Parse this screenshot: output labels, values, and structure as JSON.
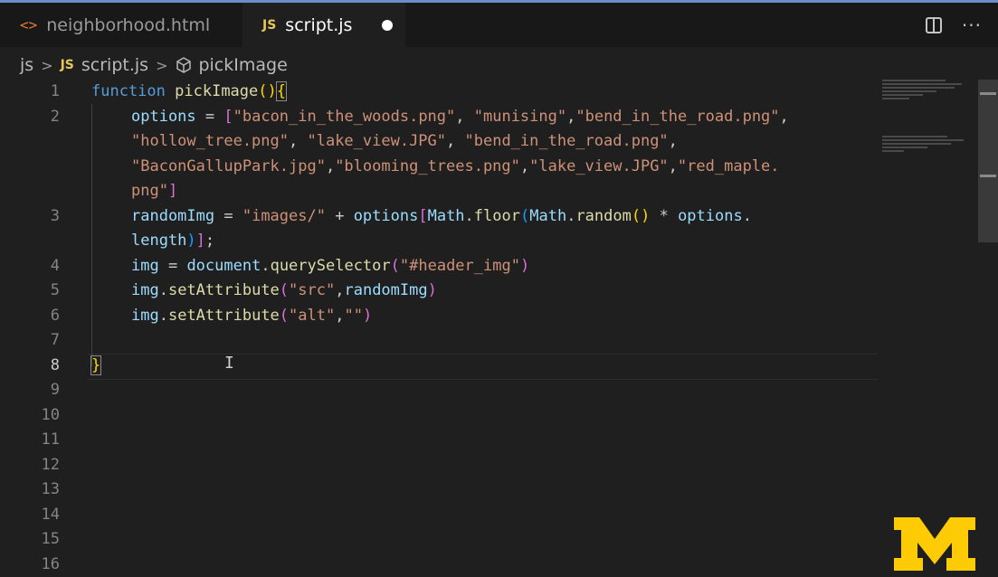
{
  "tabs": [
    {
      "icon": "<>",
      "label": "neighborhood.html"
    },
    {
      "icon": "JS",
      "label": "script.js",
      "dirty": true
    }
  ],
  "breadcrumb": {
    "folder": "js",
    "file_icon": "JS",
    "file": "script.js",
    "symbol": "pickImage"
  },
  "line_numbers": [
    "1",
    "2",
    "",
    "",
    "",
    "3",
    "",
    "4",
    "5",
    "6",
    "7",
    "8",
    "9",
    "10",
    "11",
    "12",
    "13",
    "14",
    "15",
    "16"
  ],
  "code": {
    "l1_kw": "function",
    "l1_fn": "pickImage",
    "l2a_var": "options",
    "l2a_op": " = ",
    "s_bacon_woods": "\"bacon_in_the_woods.png\"",
    "s_munising": "\"munising\"",
    "s_bend1": "\"bend_in_the_road.png\"",
    "s_hollow": "\"hollow_tree.png\"",
    "s_lake1": "\"lake_view.JPG\"",
    "s_bend2": "\"bend_in_the_road.png\"",
    "s_bacon_gallup": "\"BaconGallupPark.jpg\"",
    "s_blooming": "\"blooming_trees.png\"",
    "s_lake2": "\"lake_view.JPG\"",
    "s_red_a": "\"red_maple.",
    "s_red_b": "png\"",
    "l3_var": "randomImg",
    "l3_str": "\"images/\"",
    "l3_opts": "options",
    "l3_math": "Math",
    "l3_floor": "floor",
    "l3_random": "random",
    "l3_opts2": "options",
    "l3_length": "length",
    "l4_var": "img",
    "l4_doc": "document",
    "l4_qs": "querySelector",
    "l4_str": "\"#header_img\"",
    "l5_var": "img",
    "l5_fn": "setAttribute",
    "l5_str": "\"src\"",
    "l5_arg": "randomImg",
    "l6_var": "img",
    "l6_fn": "setAttribute",
    "l6_str1": "\"alt\"",
    "l6_str2": "\"\"",
    "l8_brace": "}"
  },
  "icons": {
    "split_editor": "split-editor-icon",
    "more": "more-actions-icon",
    "symbol": "cube-method-icon"
  },
  "colors": {
    "accent_top": "#6b8fc4",
    "logo_maize": "#ffcb05"
  }
}
